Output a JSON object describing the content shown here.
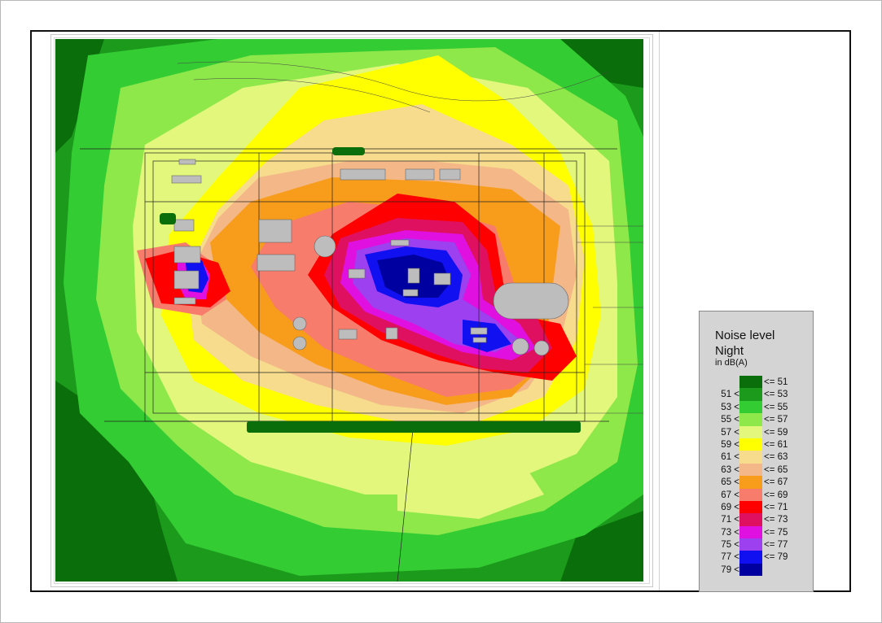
{
  "legend": {
    "title_line1": "Noise level",
    "title_line2": "Night",
    "unit": "in dB(A)",
    "classes": [
      {
        "lower": "",
        "upper": "<= 51",
        "color": "#0a6e0a"
      },
      {
        "lower": "51 <",
        "upper": "<= 53",
        "color": "#1c9a1c"
      },
      {
        "lower": "53 <",
        "upper": "<= 55",
        "color": "#33cc33"
      },
      {
        "lower": "55 <",
        "upper": "<= 57",
        "color": "#8ee84a"
      },
      {
        "lower": "57 <",
        "upper": "<= 59",
        "color": "#e2f77c"
      },
      {
        "lower": "59 <",
        "upper": "<= 61",
        "color": "#ffff00"
      },
      {
        "lower": "61 <",
        "upper": "<= 63",
        "color": "#f6dc8c"
      },
      {
        "lower": "63 <",
        "upper": "<= 65",
        "color": "#f4b888"
      },
      {
        "lower": "65 <",
        "upper": "<= 67",
        "color": "#f89c1c"
      },
      {
        "lower": "67 <",
        "upper": "<= 69",
        "color": "#f87c6c"
      },
      {
        "lower": "69 <",
        "upper": "<= 71",
        "color": "#ff0000"
      },
      {
        "lower": "71 <",
        "upper": "<= 73",
        "color": "#e01060"
      },
      {
        "lower": "73 <",
        "upper": "<= 75",
        "color": "#e010e0"
      },
      {
        "lower": "75 <",
        "upper": "<= 77",
        "color": "#9c40f0"
      },
      {
        "lower": "77 <",
        "upper": "<= 79",
        "color": "#1010f0"
      },
      {
        "lower": "79 <",
        "upper": "",
        "color": "#0000a0"
      }
    ]
  }
}
